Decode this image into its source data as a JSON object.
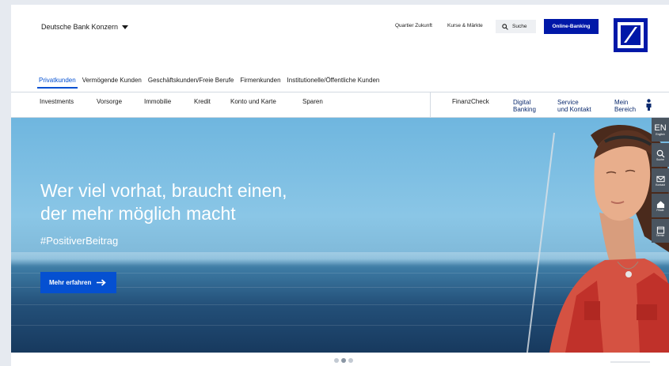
{
  "header": {
    "group_label": "Deutsche Bank Konzern",
    "links": [
      "Quartier Zukunft",
      "Kurse & Märkte"
    ],
    "search_label": "Suche",
    "online_banking_label": "Online-Banking",
    "brand_color": "#0018a8"
  },
  "segments": {
    "items": [
      {
        "label": "Privatkunden",
        "active": true
      },
      {
        "label": "Vermögende Kunden",
        "active": false
      },
      {
        "label": "Geschäftskunden/Freie Berufe",
        "active": false
      },
      {
        "label": "Firmenkunden",
        "active": false
      },
      {
        "label": "Institutionelle/Öffentliche Kunden",
        "active": false
      }
    ],
    "active_color": "#0550d1"
  },
  "nav": {
    "items": [
      "Investments",
      "Vorsorge",
      "Immobilie",
      "Kredit",
      "Konto und Karte",
      "Sparen"
    ],
    "finanzcheck": "FinanzCheck",
    "digital_banking": [
      "Digital",
      "Banking"
    ],
    "service": [
      "Service",
      "und Kontakt"
    ],
    "mein_bereich": [
      "Mein",
      "Bereich"
    ]
  },
  "hero": {
    "headline_line1": "Wer viel vorhat, braucht einen,",
    "headline_line2": "der mehr möglich macht",
    "hashtag": "#PositiverBeitrag",
    "cta_label": "Mehr erfahren"
  },
  "sidebar": {
    "items": [
      {
        "icon": "language-icon",
        "big": "EN",
        "label": "English"
      },
      {
        "icon": "search-icon",
        "label": "Suche"
      },
      {
        "icon": "mail-icon",
        "label": "Kontakt"
      },
      {
        "icon": "home-icon",
        "label": "Filiale"
      },
      {
        "icon": "calendar-icon",
        "label": "Termin"
      }
    ]
  },
  "carousel": {
    "slides": 3,
    "active_index": 1
  }
}
